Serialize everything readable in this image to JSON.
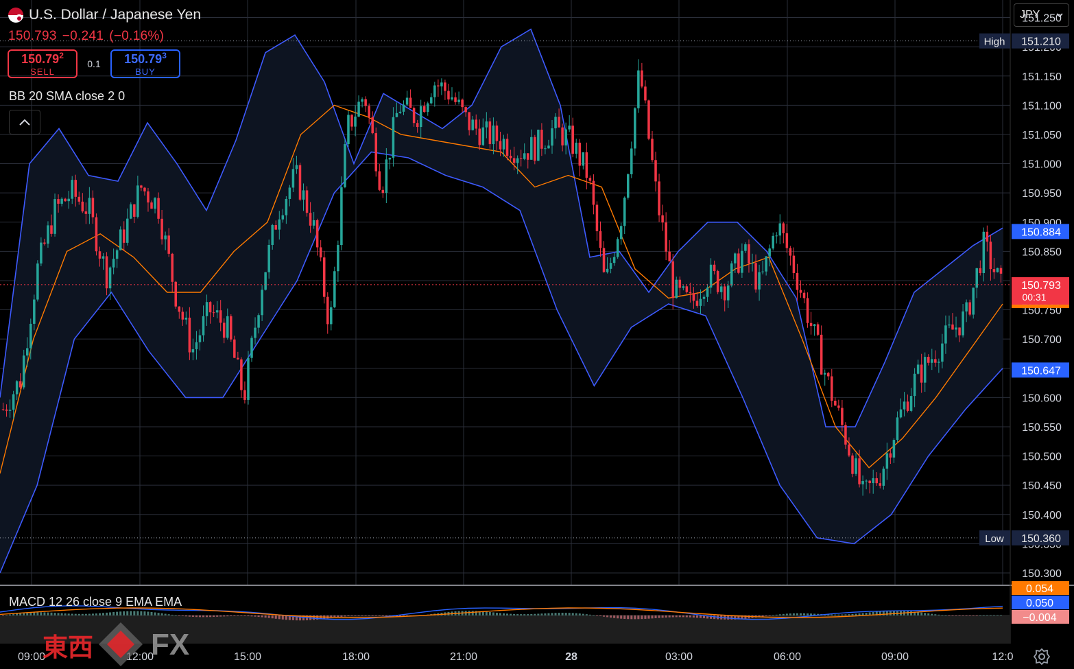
{
  "header": {
    "title": "U.S. Dollar / Japanese Yen",
    "last": "150.793",
    "change": "−0.241",
    "change_pct": "(−0.16%)"
  },
  "trade": {
    "sell_price": "150.79",
    "sell_sup": "2",
    "sell_label": "SELL",
    "spread": "0.1",
    "buy_price": "150.79",
    "buy_sup": "3",
    "buy_label": "BUY"
  },
  "indicators": {
    "bb": "BB 20 SMA close 2 0",
    "macd": "MACD 12 26 close 9 EMA EMA"
  },
  "currency_select": "JPY",
  "axis": {
    "price_ticks": [
      "151.250",
      "151.200",
      "151.150",
      "151.100",
      "151.050",
      "151.000",
      "150.950",
      "150.900",
      "150.850",
      "150.800",
      "150.750",
      "150.700",
      "150.650",
      "150.600",
      "150.550",
      "150.500",
      "150.450",
      "150.400",
      "150.350",
      "150.300"
    ],
    "time_ticks": [
      "09:00",
      "12:00",
      "15:00",
      "18:00",
      "21:00",
      "28",
      "03:00",
      "06:00",
      "09:00",
      "12:0"
    ]
  },
  "markers": {
    "high_label": "High",
    "high_value": "151.210",
    "low_label": "Low",
    "low_value": "150.360",
    "bb_upper": "150.884",
    "bb_lower": "150.647",
    "last_price": "150.793",
    "countdown": "00:31",
    "bb_basis": "150.766",
    "macd_signal": "0.054",
    "macd_line": "0.050",
    "macd_hist": "−0.004"
  },
  "colors": {
    "bull": "#26a69a",
    "bear": "#f23645",
    "band": "#3d5afe",
    "basis": "#ff7a00",
    "last": "#f23645"
  },
  "watermark": {
    "kanji": "東西",
    "fx": "FX"
  },
  "chart_data": {
    "type": "candlestick",
    "symbol": "USDJPY",
    "y_range": [
      150.28,
      151.28
    ],
    "x_labels": [
      "09:00",
      "12:00",
      "15:00",
      "18:00",
      "21:00",
      "28",
      "03:00",
      "06:00",
      "09:00",
      "12:0"
    ],
    "high": 151.21,
    "low": 150.36,
    "last": 150.793,
    "close_path": [
      150.58,
      150.63,
      150.82,
      150.92,
      150.95,
      150.92,
      150.81,
      150.88,
      150.96,
      150.93,
      150.78,
      150.68,
      150.75,
      150.72,
      150.6,
      150.79,
      150.92,
      150.98,
      150.9,
      150.72,
      151.06,
      151.12,
      150.96,
      151.1,
      151.08,
      151.14,
      151.12,
      151.07,
      151.05,
      151.04,
      151.02,
      151.03,
      151.06,
      151.04,
      150.98,
      150.79,
      150.92,
      151.16,
      150.94,
      150.78,
      150.76,
      150.81,
      150.79,
      150.85,
      150.79,
      150.9,
      150.82,
      150.72,
      150.62,
      150.53,
      150.43,
      150.47,
      150.56,
      150.63,
      150.67,
      150.71,
      150.74,
      150.86,
      150.79
    ],
    "bb_upper_path": [
      150.6,
      151.0,
      151.06,
      150.98,
      150.97,
      151.07,
      151.0,
      150.92,
      151.04,
      151.19,
      151.22,
      151.14,
      151.0,
      151.12,
      151.09,
      151.06,
      151.1,
      151.2,
      151.23,
      151.1,
      150.84,
      150.85,
      150.78,
      150.85,
      150.9,
      150.9,
      150.85,
      150.77,
      150.55,
      150.55,
      150.66,
      150.78,
      150.82,
      150.86,
      150.89
    ],
    "bb_basis_path": [
      150.47,
      150.7,
      150.85,
      150.88,
      150.84,
      150.78,
      150.78,
      150.85,
      150.9,
      151.05,
      151.1,
      151.08,
      151.05,
      151.04,
      151.03,
      151.02,
      150.96,
      150.98,
      150.96,
      150.82,
      150.77,
      150.78,
      150.82,
      150.84,
      150.7,
      150.55,
      150.48,
      150.53,
      150.6,
      150.68,
      150.76
    ],
    "bb_lower_path": [
      150.3,
      150.45,
      150.7,
      150.78,
      150.68,
      150.6,
      150.6,
      150.7,
      150.8,
      150.95,
      151.02,
      151.01,
      150.98,
      150.96,
      150.92,
      150.75,
      150.62,
      150.72,
      150.76,
      150.74,
      150.6,
      150.45,
      150.36,
      150.35,
      150.4,
      150.5,
      150.58,
      150.65
    ]
  }
}
